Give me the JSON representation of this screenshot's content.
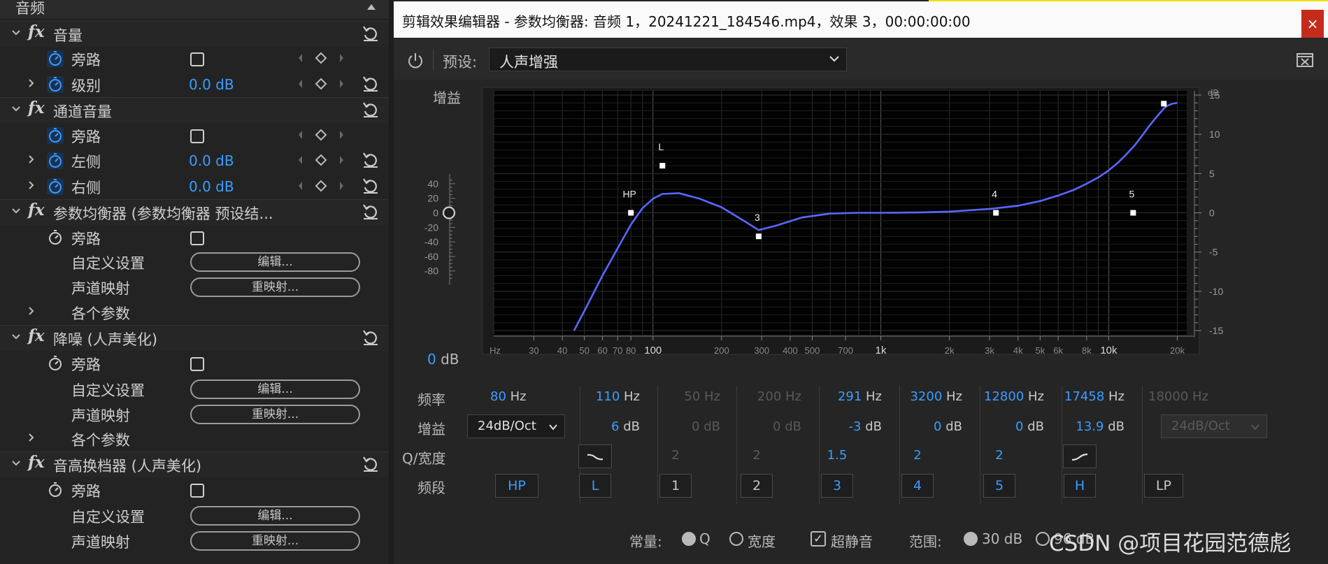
{
  "left_panel": {
    "header": "音频",
    "rows": [
      {
        "kind": "section",
        "fx": "fx",
        "name": "音量",
        "reset": true
      },
      {
        "kind": "bypass",
        "label": "旁路"
      },
      {
        "kind": "value",
        "label": "级别",
        "value": "0.0 dB",
        "expand": true
      },
      {
        "kind": "section",
        "fx": "fx",
        "name": "通道音量",
        "reset": true
      },
      {
        "kind": "bypass",
        "label": "旁路"
      },
      {
        "kind": "value",
        "label": "左侧",
        "value": "0.0 dB",
        "expand": true
      },
      {
        "kind": "value",
        "label": "右侧",
        "value": "0.0 dB",
        "expand": true
      },
      {
        "kind": "section",
        "fx": "fx",
        "name": "参数均衡器 (参数均衡器 预设结...",
        "reset": true
      },
      {
        "kind": "bypass2",
        "label": "旁路"
      },
      {
        "kind": "button",
        "label": "自定义设置",
        "button": "编辑..."
      },
      {
        "kind": "button",
        "label": "声道映射",
        "button": "重映射..."
      },
      {
        "kind": "expander",
        "label": "各个参数"
      },
      {
        "kind": "section",
        "fx": "fx",
        "name": "降噪 (人声美化)",
        "reset": true
      },
      {
        "kind": "bypass2",
        "label": "旁路"
      },
      {
        "kind": "button",
        "label": "自定义设置",
        "button": "编辑..."
      },
      {
        "kind": "button",
        "label": "声道映射",
        "button": "重映射..."
      },
      {
        "kind": "expander",
        "label": "各个参数"
      },
      {
        "kind": "section",
        "fx": "fx",
        "name": "音高换档器 (人声美化)",
        "reset": true
      },
      {
        "kind": "bypass2",
        "label": "旁路"
      },
      {
        "kind": "button",
        "label": "自定义设置",
        "button": "编辑..."
      },
      {
        "kind": "button",
        "label": "声道映射",
        "button": "重映射..."
      }
    ]
  },
  "dialog": {
    "title": "剪辑效果编辑器 - 参数均衡器: 音频 1，20241221_184546.mp4，效果 3，00:00:00:00",
    "close": "×",
    "preset_label": "预设:",
    "preset_value": "人声增强",
    "gain_label": "增益",
    "db_readout": {
      "value": "0",
      "unit": "dB"
    },
    "colors": {
      "accent": "#3a9dff",
      "curve": "#5a67ff",
      "close": "#c42b1c"
    }
  },
  "chart_data": {
    "type": "line",
    "x_scale": "log",
    "xlim": [
      20,
      22000
    ],
    "ylim": [
      -15,
      15
    ],
    "x_ticks": [
      30,
      40,
      50,
      60,
      70,
      80,
      100,
      200,
      300,
      400,
      500,
      700,
      1000,
      2000,
      3000,
      4000,
      5000,
      6000,
      8000,
      10000,
      20000
    ],
    "x_tick_labels": [
      "30",
      "40",
      "50",
      "60",
      "70",
      "80",
      "100",
      "200",
      "300",
      "400",
      "500",
      "700",
      "1k",
      "2k",
      "3k",
      "4k",
      "5k",
      "6k",
      "8k",
      "10k",
      "20k"
    ],
    "x_unit_label": "Hz",
    "y_ticks": [
      15,
      10,
      5,
      0,
      -5,
      -10,
      -15
    ],
    "y_unit_label": "dB",
    "slider_ticks": [
      40,
      20,
      0,
      -20,
      -40,
      -60,
      -80
    ],
    "series": [
      {
        "x": [
          45,
          50,
          60,
          70,
          80,
          90,
          100,
          110,
          130,
          160,
          200,
          250,
          291,
          350,
          450,
          600,
          800,
          1000,
          1500,
          2000,
          3000,
          4000,
          5000,
          6000,
          7000,
          8000,
          9000,
          10000,
          11000,
          12000,
          13000,
          14000,
          15000,
          16000,
          17000,
          17458,
          18000,
          19000,
          20000
        ],
        "y": [
          -15,
          -12.5,
          -8,
          -4.5,
          -1.5,
          0.6,
          1.8,
          2.4,
          2.5,
          1.8,
          0.7,
          -1,
          -2.2,
          -1.6,
          -0.6,
          -0.1,
          0,
          0,
          0.05,
          0.15,
          0.5,
          0.9,
          1.5,
          2.2,
          2.9,
          3.7,
          4.5,
          5.4,
          6.4,
          7.5,
          8.6,
          9.8,
          11,
          12,
          12.9,
          13.3,
          13.6,
          13.9,
          14.0
        ]
      }
    ],
    "points": [
      {
        "label": "HP",
        "x": 80,
        "y": 0
      },
      {
        "label": "L",
        "x": 110,
        "y": 6
      },
      {
        "label": "3",
        "x": 291,
        "y": -3
      },
      {
        "label": "4",
        "x": 3200,
        "y": 0
      },
      {
        "label": "5",
        "x": 12800,
        "y": 0
      },
      {
        "label": "",
        "x": 17458,
        "y": 13.9
      }
    ]
  },
  "bands": {
    "labels": {
      "freq": "频率",
      "gain": "增益",
      "q": "Q/宽度",
      "band": "频段"
    },
    "slope_left": "24dB/Oct",
    "slope_right": "24dB/Oct",
    "cols": [
      {
        "freq": "80",
        "fu": "Hz",
        "gain": "",
        "gu": "",
        "q": "",
        "btn": "HP",
        "on": true,
        "dis": false
      },
      {
        "freq": "110",
        "fu": "Hz",
        "gain": "6",
        "gu": "dB",
        "q": "",
        "btn": "L",
        "on": true,
        "dis": false
      },
      {
        "freq": "50",
        "fu": "Hz",
        "gain": "0",
        "gu": "dB",
        "q": "2",
        "btn": "1",
        "on": false,
        "dis": true
      },
      {
        "freq": "200",
        "fu": "Hz",
        "gain": "0",
        "gu": "dB",
        "q": "2",
        "btn": "2",
        "on": false,
        "dis": true
      },
      {
        "freq": "291",
        "fu": "Hz",
        "gain": "-3",
        "gu": "dB",
        "q": "1.5",
        "btn": "3",
        "on": true,
        "dis": false
      },
      {
        "freq": "3200",
        "fu": "Hz",
        "gain": "0",
        "gu": "dB",
        "q": "2",
        "btn": "4",
        "on": true,
        "dis": false
      },
      {
        "freq": "12800",
        "fu": "Hz",
        "gain": "0",
        "gu": "dB",
        "q": "2",
        "btn": "5",
        "on": true,
        "dis": false
      },
      {
        "freq": "17458",
        "fu": "Hz",
        "gain": "13.9",
        "gu": "dB",
        "q": "",
        "btn": "H",
        "on": true,
        "dis": false
      },
      {
        "freq": "18000",
        "fu": "Hz",
        "gain": "",
        "gu": "",
        "q": "",
        "btn": "LP",
        "on": false,
        "dis": true
      }
    ]
  },
  "bottom": {
    "constant_label": "常量:",
    "opt_q": "Q",
    "opt_width": "宽度",
    "ultra_quiet": "超静音",
    "range_label": "范围:",
    "range_30": "30 dB",
    "range_96": "96 dB"
  },
  "watermark": "CSDN @项目花园范德彪"
}
